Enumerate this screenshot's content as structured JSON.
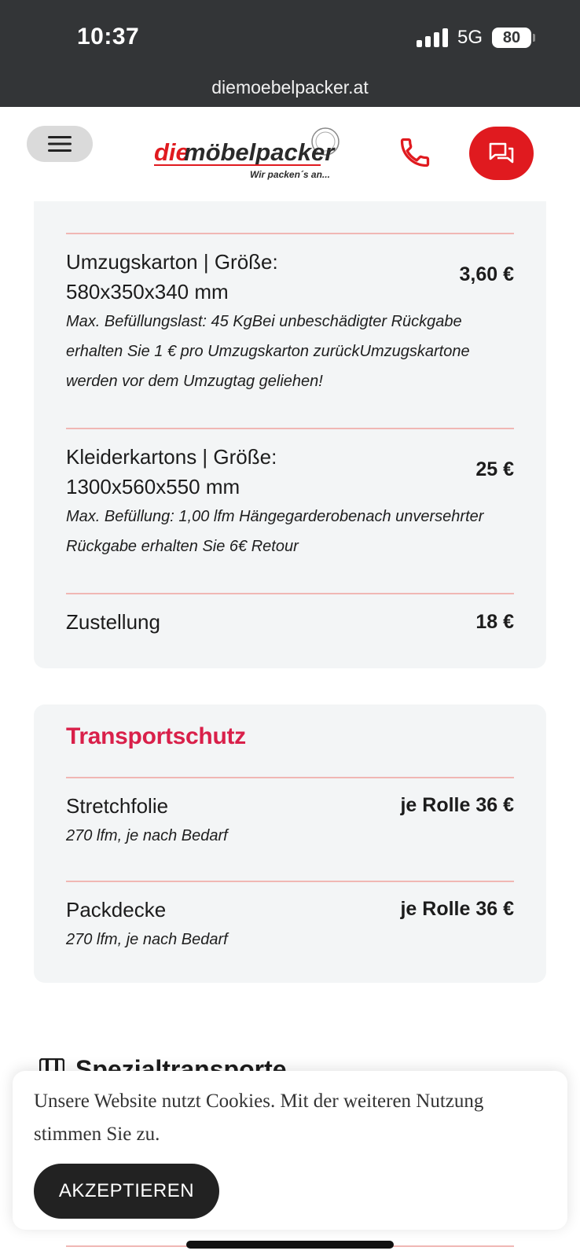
{
  "status_bar": {
    "time": "10:37",
    "network": "5G",
    "battery": "80",
    "url": "diemoebelpacker.at"
  },
  "header": {
    "logo_die": "die",
    "logo_name": "möbelpacker",
    "logo_tagline": "Wir packen´s an...",
    "icons": {
      "menu": "hamburger-icon",
      "phone": "phone-icon",
      "chat": "chat-icon"
    },
    "accent_color": "#e01a1f"
  },
  "card_packaging": {
    "items": [
      {
        "title_line1": "Umzugskarton | Größe:",
        "title_line2": "580x350x340 mm",
        "price": "3,60 €",
        "description": "Max. Befüllungslast: 45 KgBei unbeschädigter Rückgabe erhalten Sie 1 € pro Umzugskarton zurückUmzugskartone werden vor dem Umzugtag geliehen!"
      },
      {
        "title_line1": "Kleiderkartons | Größe:",
        "title_line2": "1300x560x550 mm",
        "price": "25 €",
        "description": "Max. Befüllung: 1,00 lfm Hängegarderobenach unversehrter Rückgabe erhalten Sie 6€ Retour"
      },
      {
        "title": "Zustellung",
        "price": "18 €"
      }
    ]
  },
  "card_transport": {
    "title": "Transportschutz",
    "title_color": "#d9204a",
    "items": [
      {
        "title": "Stretchfolie",
        "price": "je Rolle 36 €",
        "description": "270 lfm, je nach Bedarf"
      },
      {
        "title": "Packdecke",
        "price": "je Rolle 36 €",
        "description": "270 lfm, je nach Bedarf"
      }
    ]
  },
  "next_section": {
    "title": "Spezialtransporte",
    "icon": "piano-icon"
  },
  "cookie_banner": {
    "text": "Unsere Website nutzt Cookies. Mit der weiteren Nutzung stimmen Sie zu.",
    "button": "AKZEPTIEREN"
  }
}
